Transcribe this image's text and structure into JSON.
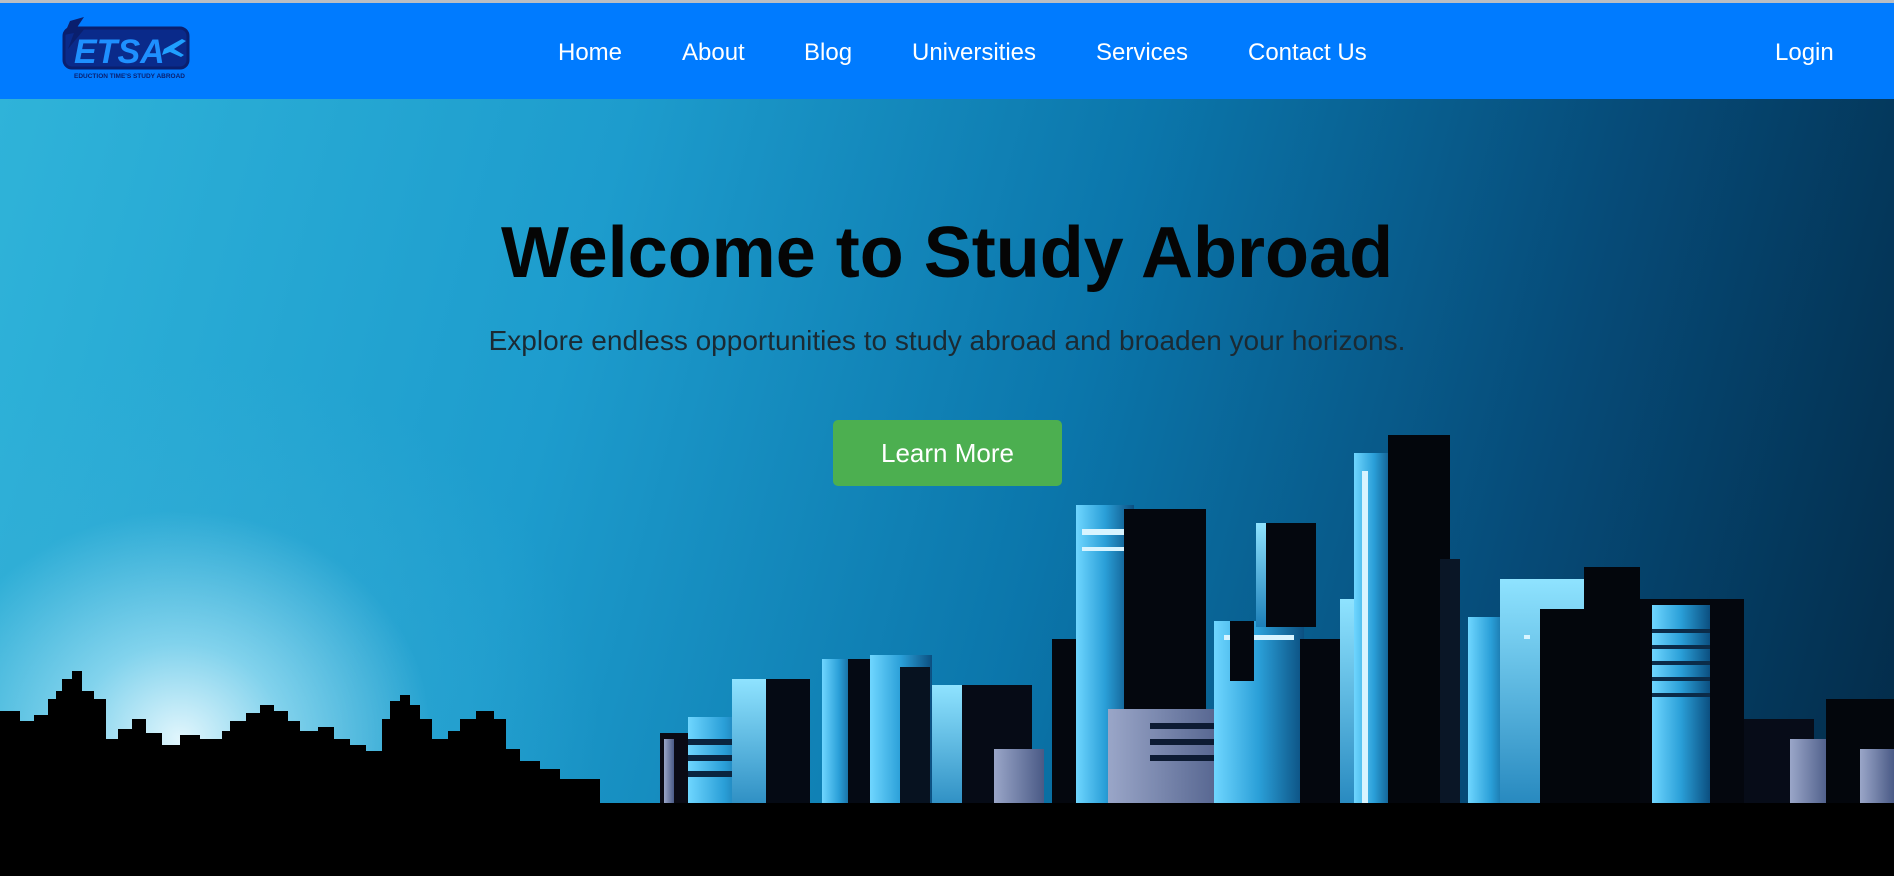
{
  "brand": {
    "logo_text": "ETSA",
    "logo_tagline": "EDUCTION TIME'S STUDY ABROAD",
    "accent_color": "#007bff",
    "logo_color": "#0a1f6e"
  },
  "nav": {
    "items": [
      {
        "label": "Home"
      },
      {
        "label": "About"
      },
      {
        "label": "Blog"
      },
      {
        "label": "Universities"
      },
      {
        "label": "Services"
      },
      {
        "label": "Contact Us"
      }
    ],
    "login_label": "Login"
  },
  "hero": {
    "title": "Welcome to Study Abroad",
    "subtitle": "Explore endless opportunities to study abroad and broaden your horizons.",
    "cta_label": "Learn More",
    "cta_color": "#4caf50"
  }
}
